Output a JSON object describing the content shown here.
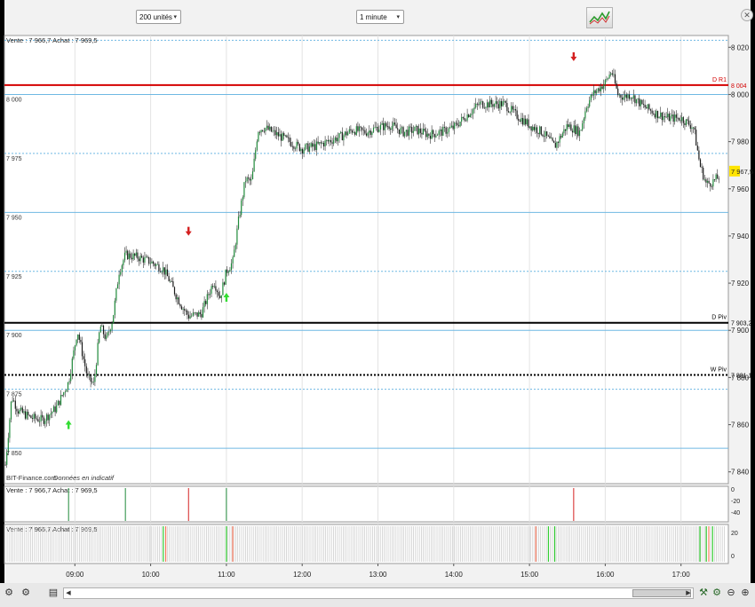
{
  "toolbar": {
    "units_select": "200 unités",
    "interval_select": "1 minute",
    "chart_type_icon": "line-chart-icon",
    "close_icon": "close-icon"
  },
  "colors": {
    "background": "#ffffff",
    "candle_up": "#1f8a3a",
    "candle_down": "#1a1a1a",
    "wick": "#333333",
    "r1_line": "#d40000",
    "pivot_line": "#000000",
    "level_line": "#6fb8e3",
    "price_badge": "#ffe400",
    "arrow_up": "#33dd33",
    "arrow_down": "#d42020"
  },
  "main": {
    "header_text": "Vente : 7 966,7 Achat : 7 969,5",
    "watermark": "BIT-Finance.com",
    "watermark_note": "Données en indicatif"
  },
  "sub1": {
    "header_text": "Vente : 7 966,7 Achat : 7 969,5",
    "ticks": [
      "0",
      "-20",
      "-40"
    ]
  },
  "sub2": {
    "header_text": "Vente : 7 966,7 Achat : 7 969,5",
    "ticks": [
      "20",
      "0"
    ]
  },
  "chart_data": {
    "type": "candlestick",
    "x_ticks": [
      "09:00",
      "10:00",
      "11:00",
      "12:00",
      "13:00",
      "14:00",
      "15:00",
      "16:00",
      "17:00"
    ],
    "y_ticks_right": [
      "8 020",
      "8 000",
      "7 980",
      "7 960",
      "7 940",
      "7 920",
      "7 900",
      "7 880",
      "7 860",
      "7 840"
    ],
    "y_ticks_left": [
      "8 000",
      "7 975",
      "7 950",
      "7 925",
      "7 900",
      "7 875",
      "7 850"
    ],
    "ylim": [
      7835,
      8025
    ],
    "current_price": "7 967,5",
    "level_lines": [
      {
        "name": "D R1",
        "value": 8004,
        "label": "8 004",
        "style": "solid",
        "color": "r1"
      },
      {
        "name": "D Piv",
        "value": 7903.2,
        "label": "7 903,2",
        "style": "solid",
        "color": "pivot"
      },
      {
        "name": "W Piv",
        "value": 7881.1,
        "label": "7 881,1",
        "style": "dotted",
        "color": "pivot"
      }
    ],
    "blue_levels": [
      {
        "value": 8000,
        "style": "solid"
      },
      {
        "value": 7975,
        "style": "dotted"
      },
      {
        "value": 7950,
        "style": "solid"
      },
      {
        "value": 7925,
        "style": "dotted"
      },
      {
        "value": 7900,
        "style": "solid"
      },
      {
        "value": 7875,
        "style": "dotted"
      },
      {
        "value": 7850,
        "style": "solid"
      },
      {
        "value": 8023,
        "style": "dotted"
      }
    ],
    "price_path": [
      [
        "08:05",
        7843
      ],
      [
        "08:10",
        7872
      ],
      [
        "08:15",
        7866
      ],
      [
        "08:25",
        7863
      ],
      [
        "08:35",
        7862
      ],
      [
        "08:45",
        7867
      ],
      [
        "08:55",
        7878
      ],
      [
        "09:02",
        7900
      ],
      [
        "09:10",
        7880
      ],
      [
        "09:15",
        7877
      ],
      [
        "09:20",
        7902
      ],
      [
        "09:25",
        7896
      ],
      [
        "09:30",
        7905
      ],
      [
        "09:35",
        7925
      ],
      [
        "09:40",
        7932
      ],
      [
        "09:50",
        7931
      ],
      [
        "10:00",
        7929
      ],
      [
        "10:10",
        7926
      ],
      [
        "10:15",
        7921
      ],
      [
        "10:20",
        7915
      ],
      [
        "10:25",
        7910
      ],
      [
        "10:30",
        7906
      ],
      [
        "10:40",
        7907
      ],
      [
        "10:50",
        7921
      ],
      [
        "10:55",
        7914
      ],
      [
        "11:00",
        7925
      ],
      [
        "11:05",
        7929
      ],
      [
        "11:10",
        7948
      ],
      [
        "11:15",
        7964
      ],
      [
        "11:20",
        7963
      ],
      [
        "11:25",
        7985
      ],
      [
        "11:30",
        7986
      ],
      [
        "11:40",
        7983
      ],
      [
        "11:50",
        7980
      ],
      [
        "12:00",
        7977
      ],
      [
        "12:10",
        7978
      ],
      [
        "12:20",
        7980
      ],
      [
        "12:30",
        7982
      ],
      [
        "12:40",
        7985
      ],
      [
        "12:50",
        7984
      ],
      [
        "13:00",
        7986
      ],
      [
        "13:10",
        7987
      ],
      [
        "13:20",
        7984
      ],
      [
        "13:30",
        7985
      ],
      [
        "13:40",
        7983
      ],
      [
        "13:50",
        7984
      ],
      [
        "14:00",
        7986
      ],
      [
        "14:10",
        7991
      ],
      [
        "14:20",
        7996
      ],
      [
        "14:30",
        7996
      ],
      [
        "14:40",
        7996
      ],
      [
        "14:50",
        7991
      ],
      [
        "15:00",
        7987
      ],
      [
        "15:10",
        7984
      ],
      [
        "15:20",
        7978
      ],
      [
        "15:30",
        7987
      ],
      [
        "15:40",
        7984
      ],
      [
        "15:45",
        7995
      ],
      [
        "15:50",
        8000
      ],
      [
        "16:00",
        8005
      ],
      [
        "16:05",
        8010
      ],
      [
        "16:10",
        8000
      ],
      [
        "16:15",
        7999
      ],
      [
        "16:20",
        8000
      ],
      [
        "16:30",
        7995
      ],
      [
        "16:40",
        7992
      ],
      [
        "16:50",
        7990
      ],
      [
        "17:00",
        7990
      ],
      [
        "17:10",
        7986
      ],
      [
        "17:15",
        7970
      ],
      [
        "17:20",
        7962
      ],
      [
        "17:25",
        7963
      ],
      [
        "17:30",
        7965
      ]
    ],
    "signals": [
      {
        "time": "08:55",
        "dir": "up",
        "price": 7860
      },
      {
        "time": "10:30",
        "dir": "down",
        "price": 7942
      },
      {
        "time": "11:00",
        "dir": "up",
        "price": 7914
      },
      {
        "time": "15:35",
        "dir": "down",
        "price": 8016
      }
    ],
    "sub1_spikes": [
      "08:55",
      "09:40",
      "10:30",
      "11:00",
      "15:35"
    ],
    "sub2_green_bars": [
      "10:10",
      "11:00",
      "15:15",
      "15:20",
      "17:15",
      "17:20",
      "17:25"
    ],
    "sub2_red_bars": [
      "10:12",
      "11:05",
      "15:05",
      "17:22"
    ]
  },
  "bottom": {
    "icons": [
      "tools-icon",
      "pages-icon",
      "scroll-left-icon",
      "scroll-right-icon",
      "chart-settings-icon",
      "settings-icon",
      "zoom-out-icon",
      "zoom-in-icon"
    ]
  }
}
